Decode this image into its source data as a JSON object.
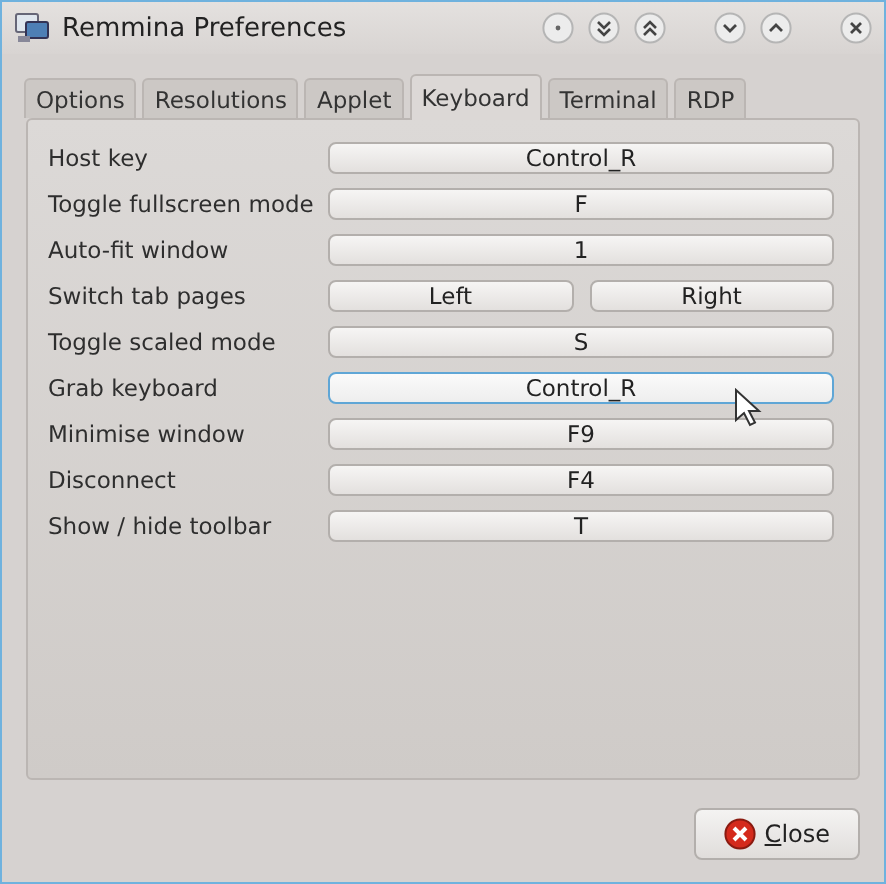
{
  "window": {
    "title": "Remmina Preferences"
  },
  "tabs": [
    {
      "label": "Options",
      "selected": false
    },
    {
      "label": "Resolutions",
      "selected": false
    },
    {
      "label": "Applet",
      "selected": false
    },
    {
      "label": "Keyboard",
      "selected": true
    },
    {
      "label": "Terminal",
      "selected": false
    },
    {
      "label": "RDP",
      "selected": false
    }
  ],
  "shortcuts": [
    {
      "label": "Host key",
      "keys": [
        {
          "value": "Control_R",
          "focused": false
        }
      ]
    },
    {
      "label": "Toggle fullscreen mode",
      "keys": [
        {
          "value": "F",
          "focused": false
        }
      ]
    },
    {
      "label": "Auto-fit window",
      "keys": [
        {
          "value": "1",
          "focused": false
        }
      ]
    },
    {
      "label": "Switch tab pages",
      "keys": [
        {
          "value": "Left",
          "focused": false
        },
        {
          "value": "Right",
          "focused": false
        }
      ]
    },
    {
      "label": "Toggle scaled mode",
      "keys": [
        {
          "value": "S",
          "focused": false
        }
      ]
    },
    {
      "label": "Grab keyboard",
      "keys": [
        {
          "value": "Control_R",
          "focused": true
        }
      ]
    },
    {
      "label": "Minimise window",
      "keys": [
        {
          "value": "F9",
          "focused": false
        }
      ]
    },
    {
      "label": "Disconnect",
      "keys": [
        {
          "value": "F4",
          "focused": false
        }
      ]
    },
    {
      "label": "Show / hide toolbar",
      "keys": [
        {
          "value": "T",
          "focused": false
        }
      ]
    }
  ],
  "close_button": {
    "label": "Close",
    "mnemonic_underlined": true
  }
}
